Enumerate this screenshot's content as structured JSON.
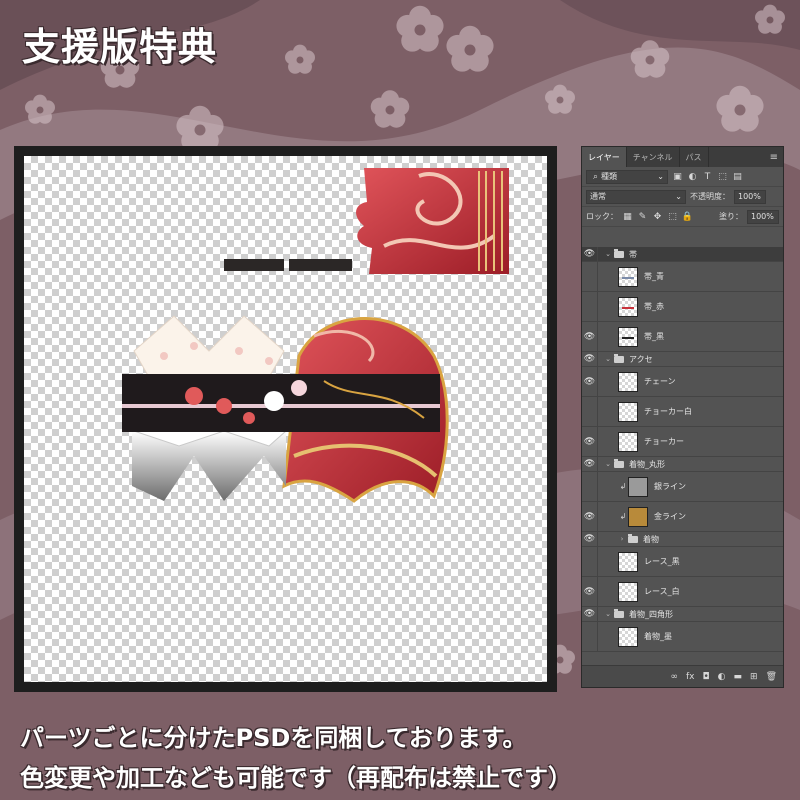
{
  "title": "支援版特典",
  "caption": {
    "line1": "パーツごとに分けたPSDを同梱しております。",
    "line2": "色変更や加工なども可能です（再配布は禁止です）"
  },
  "colors": {
    "background": "#7d5f66",
    "stripe": "#a18890",
    "blossom": "#d7c4c9",
    "panel": "#535353",
    "accent_red": "#c8313a",
    "accent_gold": "#d9a441"
  },
  "panel": {
    "tabs": [
      {
        "label": "レイヤー",
        "active": true
      },
      {
        "label": "チャンネル",
        "active": false
      },
      {
        "label": "パス",
        "active": false
      }
    ],
    "menu_icon": "panel-menu-icon",
    "filter": {
      "value": "種類",
      "icons": [
        "image-filter-icon",
        "adjustment-filter-icon",
        "type-filter-icon",
        "shape-filter-icon",
        "smart-object-filter-icon"
      ]
    },
    "blend": {
      "value": "通常",
      "opacity_label": "不透明度：",
      "opacity_value": "100%"
    },
    "lock": {
      "label": "ロック：",
      "fill_label": "塗り：",
      "fill_value": "100%"
    },
    "layers": [
      {
        "kind": "group",
        "name": "帯",
        "visible": true,
        "expanded": true,
        "indent": 0,
        "selected": true
      },
      {
        "kind": "layer",
        "name": "帯_青",
        "visible": false,
        "indent": 1,
        "thumb": "#7a8aa8"
      },
      {
        "kind": "layer",
        "name": "帯_赤",
        "visible": false,
        "indent": 1,
        "thumb": "#c8313a"
      },
      {
        "kind": "layer",
        "name": "帯_黒",
        "visible": true,
        "indent": 1,
        "thumb": "#222222"
      },
      {
        "kind": "group",
        "name": "アクセ",
        "visible": true,
        "expanded": true,
        "indent": 0
      },
      {
        "kind": "layer",
        "name": "チェーン",
        "visible": true,
        "indent": 1
      },
      {
        "kind": "layer",
        "name": "チョーカー白",
        "visible": false,
        "indent": 1
      },
      {
        "kind": "layer",
        "name": "チョーカー",
        "visible": true,
        "indent": 1
      },
      {
        "kind": "group",
        "name": "着物_丸形",
        "visible": true,
        "expanded": true,
        "indent": 0
      },
      {
        "kind": "layer",
        "name": "銀ライン",
        "visible": false,
        "indent": 1,
        "clip": true,
        "thumb_fill": "#9a9a9a"
      },
      {
        "kind": "layer",
        "name": "金ライン",
        "visible": true,
        "indent": 1,
        "clip": true,
        "thumb_fill": "#b88a3a"
      },
      {
        "kind": "group",
        "name": "着物",
        "visible": true,
        "expanded": false,
        "indent": 1
      },
      {
        "kind": "layer",
        "name": "レース_黒",
        "visible": false,
        "indent": 1
      },
      {
        "kind": "layer",
        "name": "レース_白",
        "visible": true,
        "indent": 1
      },
      {
        "kind": "group",
        "name": "着物_四角形",
        "visible": true,
        "expanded": true,
        "indent": 0
      },
      {
        "kind": "layer",
        "name": "着物_墨",
        "visible": false,
        "indent": 1
      }
    ],
    "footer_icons": [
      "link-layers-icon",
      "layer-style-icon",
      "layer-mask-icon",
      "adjustment-layer-icon",
      "new-group-icon",
      "new-layer-icon",
      "delete-layer-icon"
    ],
    "footer_glyphs": [
      "∞",
      "fx",
      "◘",
      "◐",
      "▬",
      "⊞",
      "🗑"
    ]
  }
}
